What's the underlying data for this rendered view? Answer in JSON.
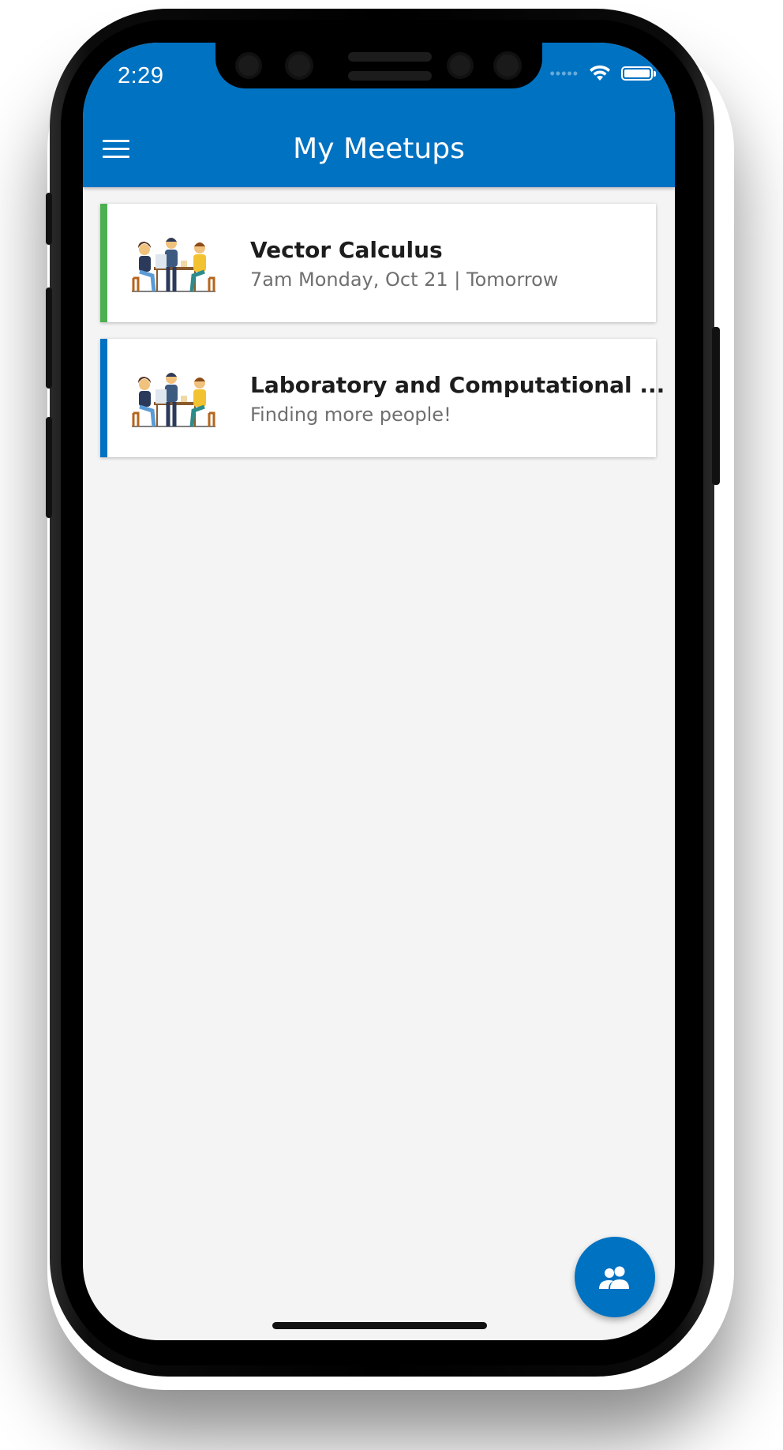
{
  "status_bar": {
    "time": "2:29",
    "signal_icon": "signal-dots-icon",
    "wifi_icon": "wifi-icon",
    "battery_icon": "battery-icon"
  },
  "app_bar": {
    "title": "My Meetups",
    "menu_icon": "hamburger-menu-icon",
    "color": "#0072c2"
  },
  "meetups": [
    {
      "title": "Vector Calculus",
      "subtitle": "7am Monday, Oct 21 | Tomorrow",
      "accent": "#4caf50",
      "image_icon": "group-study-illustration"
    },
    {
      "title": "Laboratory and Computational ...",
      "subtitle": "Finding more people!",
      "accent": "#0072c2",
      "image_icon": "group-study-illustration"
    }
  ],
  "fab": {
    "icon": "people-icon",
    "color": "#0072c2"
  }
}
